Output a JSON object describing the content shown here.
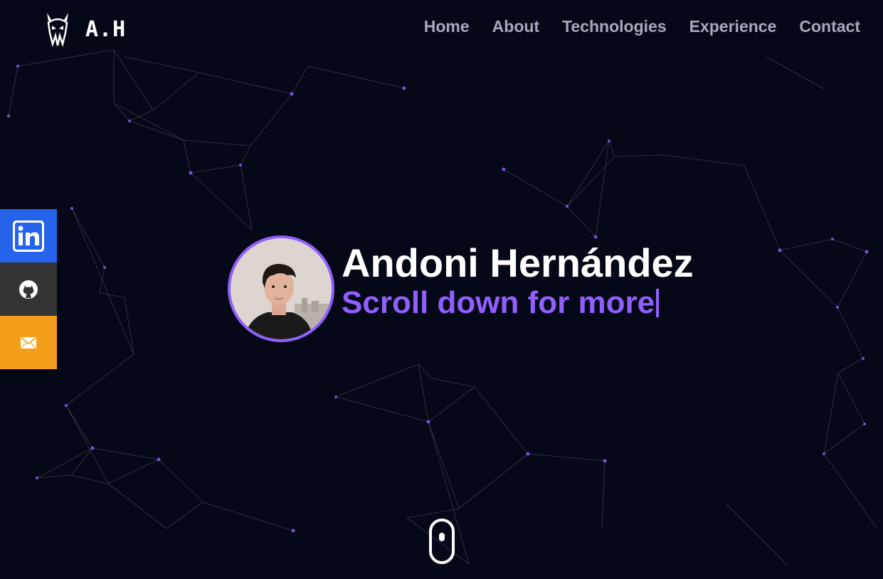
{
  "logo": {
    "text": "A.H",
    "icon": "skull-logo-icon"
  },
  "nav": {
    "items": [
      {
        "label": "Home"
      },
      {
        "label": "About"
      },
      {
        "label": "Technologies"
      },
      {
        "label": "Experience"
      },
      {
        "label": "Contact"
      }
    ]
  },
  "socials": [
    {
      "name": "linkedin",
      "icon": "linkedin-icon",
      "color": "#2563eb"
    },
    {
      "name": "github",
      "icon": "github-icon",
      "color": "#333333"
    },
    {
      "name": "email",
      "icon": "envelope-icon",
      "color": "#f59e1b"
    }
  ],
  "hero": {
    "name": "Andoni Hernández",
    "subtitle": "Scroll down for more"
  },
  "colors": {
    "background": "#050816",
    "accent": "#915eff",
    "nav_text": "#aaa6c3"
  }
}
